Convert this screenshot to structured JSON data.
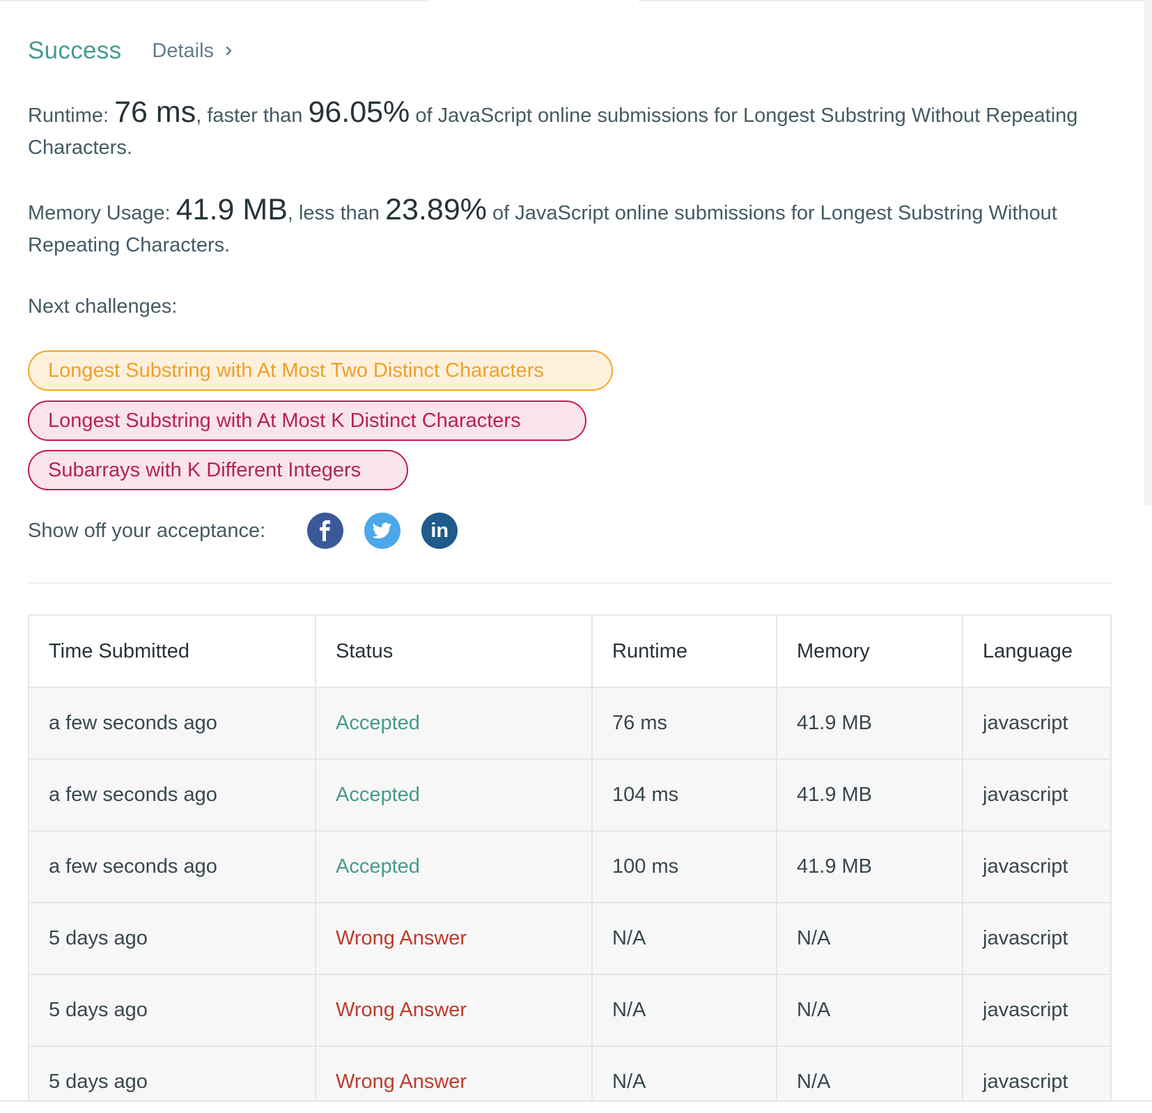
{
  "header": {
    "status": "Success",
    "details_label": "Details"
  },
  "runtime_stat": {
    "label": "Runtime:",
    "value": "76 ms",
    "mid": ", faster than",
    "percent": "96.05%",
    "suffix": "of JavaScript online submissions for Longest Substring Without Repeating Characters."
  },
  "memory_stat": {
    "label": "Memory Usage:",
    "value": "41.9 MB",
    "mid": ", less than",
    "percent": "23.89%",
    "suffix": "of JavaScript online submissions for Longest Substring Without Repeating Characters."
  },
  "next_challenges": {
    "label": "Next challenges:",
    "items": [
      {
        "label": "Longest Substring with At Most Two Distinct Characters",
        "difficulty": "medium"
      },
      {
        "label": "Longest Substring with At Most K Distinct Characters",
        "difficulty": "hard"
      },
      {
        "label": "Subarrays with K Different Integers",
        "difficulty": "hard"
      }
    ]
  },
  "share": {
    "label": "Show off your acceptance:",
    "icons": [
      "facebook-icon",
      "twitter-icon",
      "linkedin-icon"
    ],
    "linkedin_text": "in"
  },
  "colors": {
    "success": "#459b8f",
    "wrong": "#c0392b",
    "medium": "#f0a027",
    "hard": "#b8205a",
    "facebook": "#3b5998",
    "twitter": "#4da7e8",
    "linkedin": "#1f5a8c"
  },
  "table": {
    "headers": [
      "Time Submitted",
      "Status",
      "Runtime",
      "Memory",
      "Language"
    ],
    "rows": [
      {
        "time": "a few seconds ago",
        "status": "Accepted",
        "runtime": "76 ms",
        "memory": "41.9 MB",
        "language": "javascript"
      },
      {
        "time": "a few seconds ago",
        "status": "Accepted",
        "runtime": "104 ms",
        "memory": "41.9 MB",
        "language": "javascript"
      },
      {
        "time": "a few seconds ago",
        "status": "Accepted",
        "runtime": "100 ms",
        "memory": "41.9 MB",
        "language": "javascript"
      },
      {
        "time": "5 days ago",
        "status": "Wrong Answer",
        "runtime": "N/A",
        "memory": "N/A",
        "language": "javascript"
      },
      {
        "time": "5 days ago",
        "status": "Wrong Answer",
        "runtime": "N/A",
        "memory": "N/A",
        "language": "javascript"
      },
      {
        "time": "5 days ago",
        "status": "Wrong Answer",
        "runtime": "N/A",
        "memory": "N/A",
        "language": "javascript"
      }
    ]
  }
}
